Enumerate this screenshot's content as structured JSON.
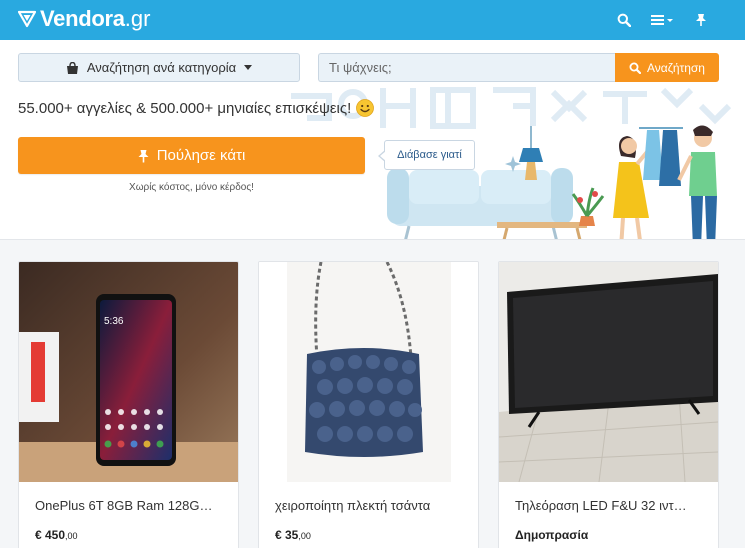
{
  "brand": {
    "name": "Vendora",
    "tld": ".gr",
    "color": "#29a9e0",
    "accent": "#f7941d"
  },
  "nav": {
    "icons": [
      "search-icon",
      "menu-icon",
      "pin-icon"
    ]
  },
  "hero": {
    "category_label": "Αναζήτηση ανά κατηγορία",
    "search_placeholder": "Τι ψάχνεις;",
    "search_button": "Αναζήτηση",
    "tagline": "55.000+ αγγελίες & 500.000+ μηνιαίες επισκέψεις!",
    "sell_button": "Πούλησε κάτι",
    "sell_subtext": "Χωρίς κόστος, μόνο κέρδος!",
    "read_why": "Διάβασε γιατί"
  },
  "listings": [
    {
      "title": "OnePlus 6T 8GB Ram 128G…",
      "price_main": "€ 450",
      "price_cents": ",00"
    },
    {
      "title": "χειροποίητη πλεκτή τσάντα",
      "price_main": "€ 35",
      "price_cents": ",00"
    },
    {
      "title": "Τηλεόραση LED F&U 32 ιντ…",
      "auction_label": "Δημοπρασία"
    }
  ]
}
